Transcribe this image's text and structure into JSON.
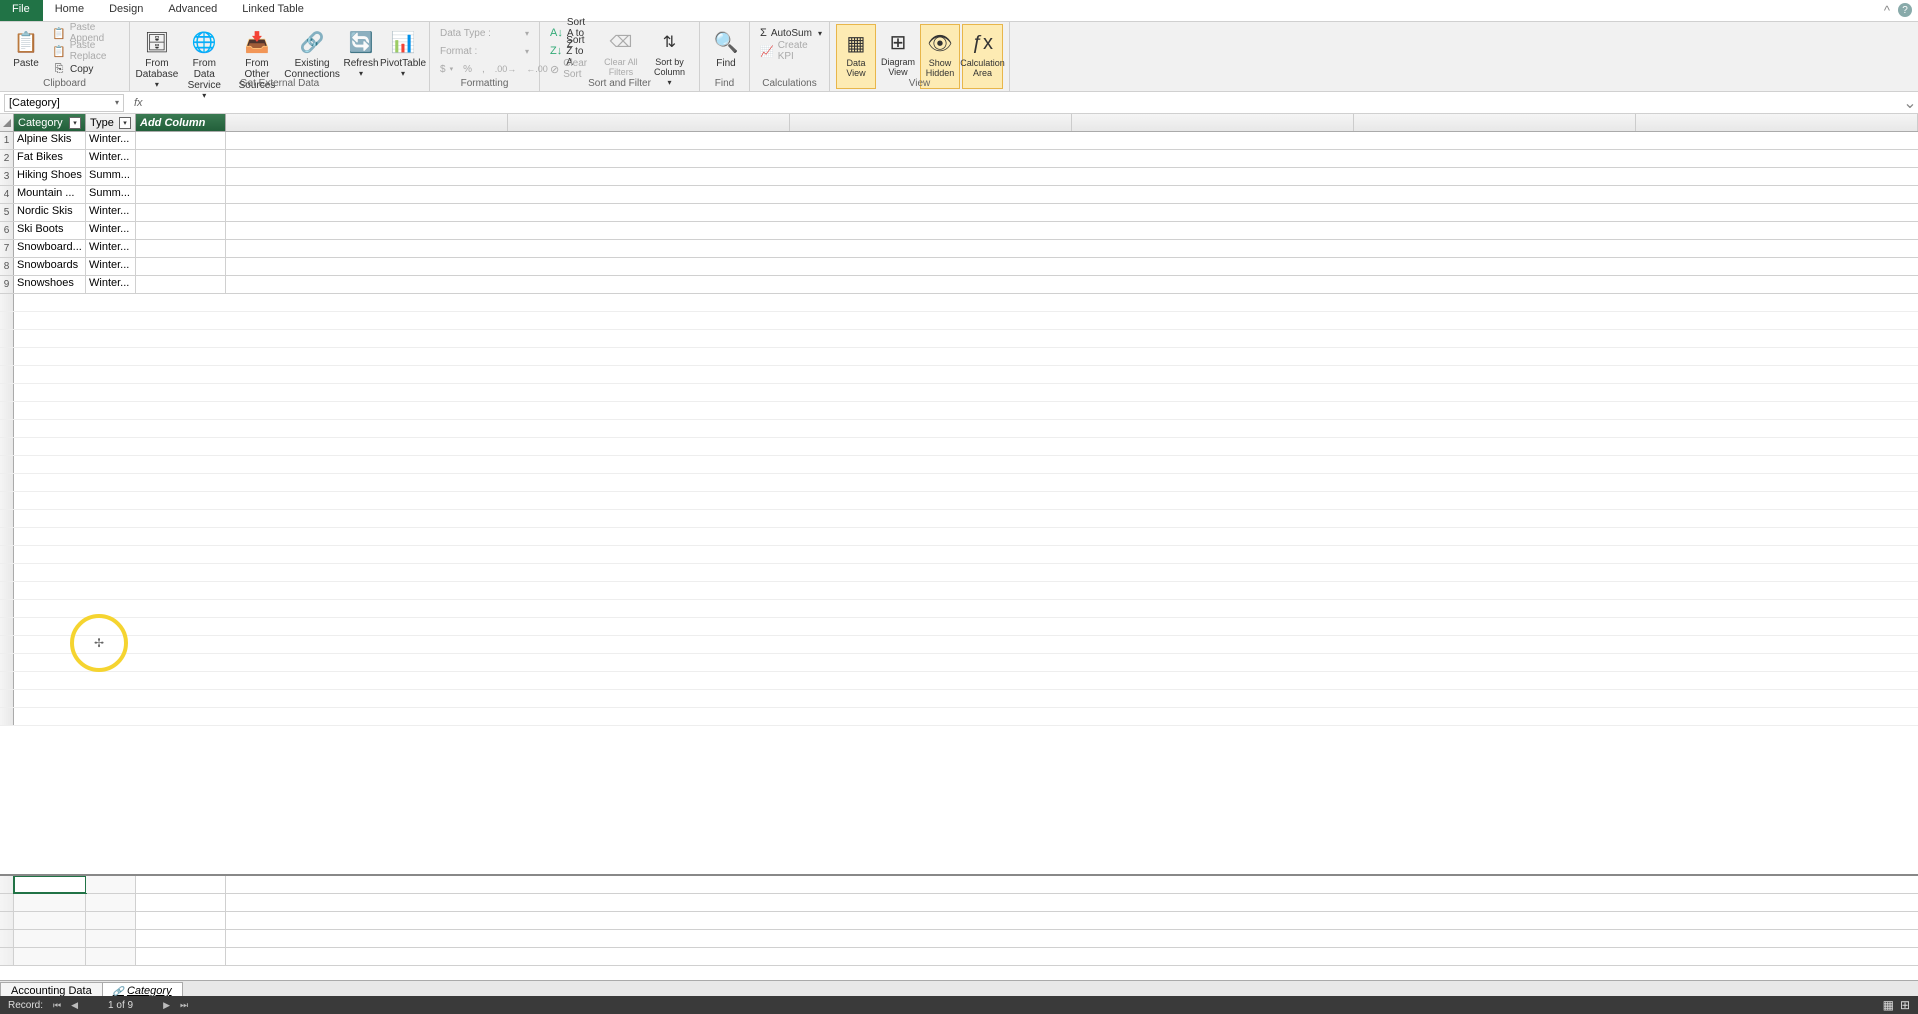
{
  "tabs": {
    "file": "File",
    "home": "Home",
    "design": "Design",
    "advanced": "Advanced",
    "linked_table": "Linked Table"
  },
  "ribbon": {
    "clipboard": {
      "label": "Clipboard",
      "paste": "Paste",
      "paste_append": "Paste Append",
      "paste_replace": "Paste Replace",
      "copy": "Copy"
    },
    "get_external_data": {
      "label": "Get External Data",
      "from_database": "From Database",
      "from_data_service": "From Data Service",
      "from_other_sources": "From Other Sources",
      "existing_connections": "Existing Connections",
      "refresh": "Refresh",
      "pivottable": "PivotTable"
    },
    "formatting": {
      "label": "Formatting",
      "data_type": "Data Type :",
      "format": "Format :"
    },
    "sort_filter": {
      "label": "Sort and Filter",
      "sort_az": "Sort A to Z",
      "sort_za": "Sort Z to A",
      "clear_sort": "Clear Sort",
      "clear_filters": "Clear All Filters",
      "sort_by_column": "Sort by Column"
    },
    "find": {
      "label": "Find",
      "find": "Find"
    },
    "calculations": {
      "label": "Calculations",
      "autosum": "AutoSum",
      "create_kpi": "Create KPI"
    },
    "view": {
      "label": "View",
      "data_view": "Data View",
      "diagram_view": "Diagram View",
      "show_hidden": "Show Hidden",
      "calculation_area": "Calculation Area"
    }
  },
  "name_box": "[Category]",
  "columns": {
    "category": "Category",
    "type": "Type",
    "add_column": "Add Column"
  },
  "rows": [
    {
      "n": "1",
      "category": "Alpine Skis",
      "type": "Winter..."
    },
    {
      "n": "2",
      "category": "Fat Bikes",
      "type": "Winter..."
    },
    {
      "n": "3",
      "category": "Hiking Shoes",
      "type": "Summ..."
    },
    {
      "n": "4",
      "category": "Mountain ...",
      "type": "Summ..."
    },
    {
      "n": "5",
      "category": "Nordic Skis",
      "type": "Winter..."
    },
    {
      "n": "6",
      "category": "Ski Boots",
      "type": "Winter..."
    },
    {
      "n": "7",
      "category": "Snowboard...",
      "type": "Winter..."
    },
    {
      "n": "8",
      "category": "Snowboards",
      "type": "Winter..."
    },
    {
      "n": "9",
      "category": "Snowshoes",
      "type": "Winter..."
    }
  ],
  "sheet_tabs": {
    "accounting_data": "Accounting Data",
    "category": "Category"
  },
  "status": {
    "record_label": "Record:",
    "position": "1 of 9"
  }
}
